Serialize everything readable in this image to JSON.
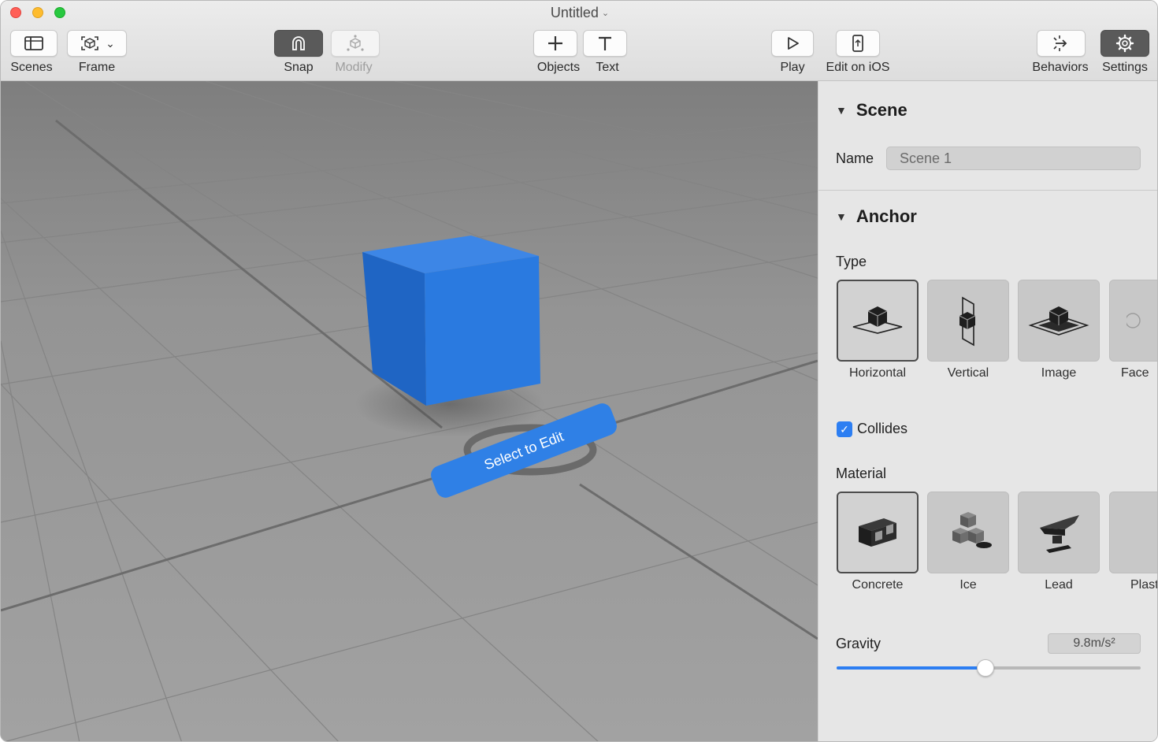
{
  "window": {
    "title": "Untitled"
  },
  "toolbar": {
    "scenes_label": "Scenes",
    "frame_label": "Frame",
    "snap_label": "Snap",
    "modify_label": "Modify",
    "objects_label": "Objects",
    "text_label": "Text",
    "play_label": "Play",
    "edit_on_ios_label": "Edit on iOS",
    "behaviors_label": "Behaviors",
    "settings_label": "Settings"
  },
  "viewport": {
    "hint_text": "Select to Edit",
    "object_color": "#2878e0"
  },
  "inspector": {
    "scene": {
      "heading": "Scene",
      "name_label": "Name",
      "name_value": "Scene 1"
    },
    "anchor": {
      "heading": "Anchor",
      "type_label": "Type",
      "types": [
        {
          "label": "Horizontal",
          "icon": "horizontal-anchor-icon",
          "selected": true
        },
        {
          "label": "Vertical",
          "icon": "vertical-anchor-icon",
          "selected": false
        },
        {
          "label": "Image",
          "icon": "image-anchor-icon",
          "selected": false
        },
        {
          "label": "Face",
          "icon": "face-anchor-icon",
          "selected": false
        }
      ],
      "collides_label": "Collides",
      "collides_checked": true,
      "material_label": "Material",
      "materials": [
        {
          "label": "Concrete",
          "icon": "concrete-block-icon",
          "selected": true
        },
        {
          "label": "Ice",
          "icon": "ice-cubes-icon",
          "selected": false
        },
        {
          "label": "Lead",
          "icon": "anvil-icon",
          "selected": false
        },
        {
          "label": "Plastic",
          "icon": "plastic-bottle-icon",
          "selected": false
        }
      ],
      "gravity_label": "Gravity",
      "gravity_value": "9.8m/s²",
      "gravity_fraction": 0.49
    }
  },
  "colors": {
    "accent": "#2c7ef2"
  }
}
